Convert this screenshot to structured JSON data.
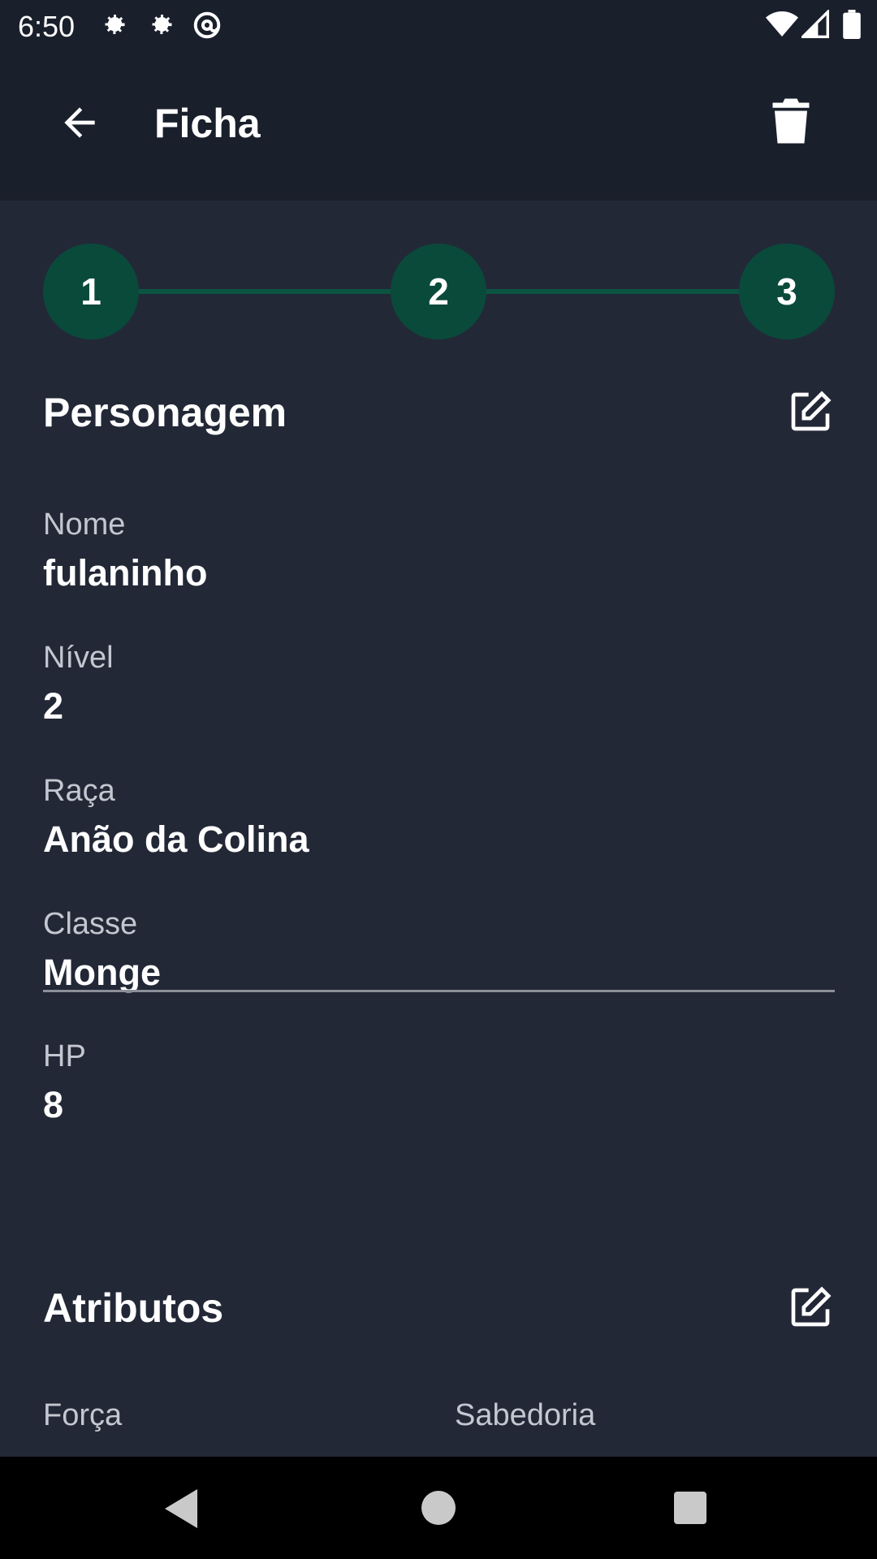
{
  "status_bar": {
    "time": "6:50",
    "icons": [
      "gear-icon",
      "gear-icon",
      "at-sign-icon",
      "wifi-icon",
      "signal-icon",
      "battery-icon"
    ]
  },
  "app_bar": {
    "title": "Ficha",
    "back_icon": "arrow-left-icon",
    "delete_icon": "trash-icon"
  },
  "stepper": {
    "steps": [
      "1",
      "2",
      "3"
    ],
    "color": "#0a4a3b"
  },
  "personagem": {
    "title": "Personagem",
    "fields": [
      {
        "label": "Nome",
        "value": "fulaninho"
      },
      {
        "label": "Nível",
        "value": "2"
      },
      {
        "label": "Raça",
        "value": "Anão da Colina"
      },
      {
        "label": "Classe",
        "value": "Monge"
      },
      {
        "label": "HP",
        "value": "8"
      }
    ]
  },
  "atributos": {
    "title": "Atributos",
    "left_label": "Força",
    "right_label": "Sabedoria"
  },
  "colors": {
    "background": "#232837",
    "app_bar": "#1a1f2c",
    "accent": "#0a4a3b"
  }
}
